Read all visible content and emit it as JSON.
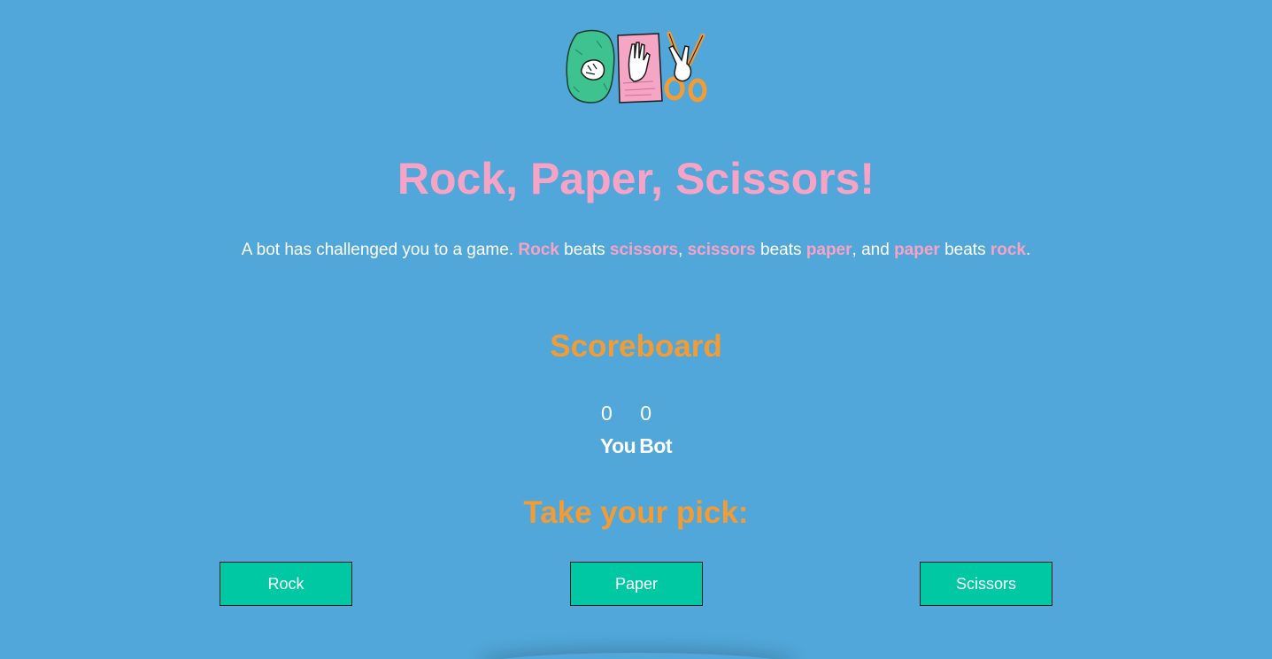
{
  "header": {
    "title": "Rock, Paper, Scissors!"
  },
  "intro": {
    "prefix": "A bot has challenged you to a game. ",
    "w1": "Rock",
    "t1": " beats ",
    "w2": "scissors",
    "t2": ", ",
    "w3": "scissors",
    "t3": " beats ",
    "w4": "paper",
    "t4": ", and ",
    "w5": "paper",
    "t5": " beats ",
    "w6": "rock",
    "t6": "."
  },
  "scoreboard": {
    "title": "Scoreboard",
    "player_score": "0",
    "bot_score": "0",
    "player_label": "You",
    "bot_label": "Bot"
  },
  "pick": {
    "title": "Take your pick:",
    "options": [
      "Rock",
      "Paper",
      "Scissors"
    ]
  },
  "colors": {
    "background": "#51a7d9",
    "title": "#f7a3c5",
    "heading": "#f39c35",
    "button": "#00c8a3"
  },
  "icons": [
    "rock-icon",
    "paper-icon",
    "scissors-icon"
  ]
}
